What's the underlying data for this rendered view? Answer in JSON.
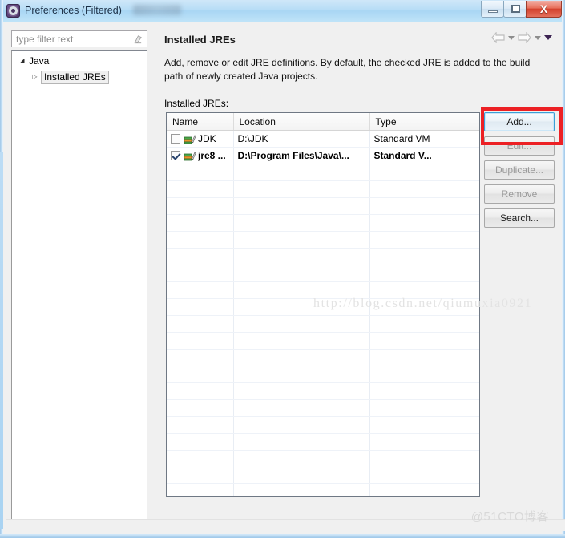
{
  "window": {
    "title": "Preferences (Filtered)",
    "icon": "preferences-gear-icon",
    "buttons": {
      "minimize": "minimize-icon",
      "maximize": "maximize-icon",
      "close": "X"
    }
  },
  "sidebar": {
    "filter": {
      "value": "",
      "placeholder": "type filter text",
      "clear_icon": "eraser-icon"
    },
    "tree": [
      {
        "label": "Java",
        "expanded": true,
        "twisty": "◢",
        "level": 1,
        "selected": false
      },
      {
        "label": "Installed JREs",
        "expanded": false,
        "twisty": "▷",
        "level": 2,
        "selected": true
      }
    ]
  },
  "content": {
    "title": "Installed JREs",
    "nav": {
      "back_icon": "back-arrow-icon",
      "back_menu_icon": "chevron-down-icon",
      "forward_icon": "forward-arrow-icon",
      "forward_menu_icon": "chevron-down-icon",
      "view_menu_icon": "chevron-down-icon"
    },
    "description": "Add, remove or edit JRE definitions. By default, the checked JRE is added to the build path of newly created Java projects.",
    "table_label": "Installed JREs:",
    "table": {
      "columns": [
        "Name",
        "Location",
        "Type",
        ""
      ],
      "rows": [
        {
          "checked": false,
          "bold": false,
          "icon": "jre-library-icon",
          "name": "JDK",
          "location": "D:\\JDK",
          "type": "Standard VM",
          "extra": ""
        },
        {
          "checked": true,
          "bold": true,
          "icon": "jre-library-icon",
          "name": "jre8 ...",
          "location": "D:\\Program Files\\Java\\...",
          "type": "Standard V...",
          "extra": ""
        }
      ],
      "empty_row_count": 21
    },
    "buttons": [
      {
        "label": "Add...",
        "enabled": true,
        "focused": true
      },
      {
        "label": "Edit...",
        "enabled": false,
        "focused": false
      },
      {
        "label": "Duplicate...",
        "enabled": false,
        "focused": false
      },
      {
        "label": "Remove",
        "enabled": false,
        "focused": false
      },
      {
        "label": "Search...",
        "enabled": true,
        "focused": false
      }
    ]
  },
  "annotation": {
    "highlight_color": "#ec2024",
    "highlight_target": "Add... button"
  },
  "watermarks": {
    "url": "http://blog.csdn.net/qiumuxia0921",
    "site": "@51CTO博客"
  }
}
